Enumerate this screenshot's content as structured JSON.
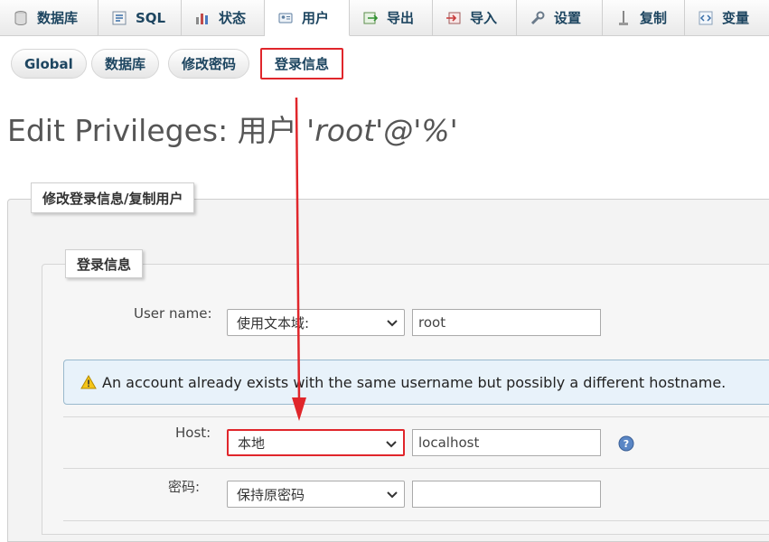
{
  "top_tabs": [
    {
      "label": "数据库",
      "icon": "database-icon"
    },
    {
      "label": "SQL",
      "icon": "sql-icon"
    },
    {
      "label": "状态",
      "icon": "status-icon"
    },
    {
      "label": "用户",
      "icon": "users-icon"
    },
    {
      "label": "导出",
      "icon": "export-icon"
    },
    {
      "label": "导入",
      "icon": "import-icon"
    },
    {
      "label": "设置",
      "icon": "settings-icon"
    },
    {
      "label": "复制",
      "icon": "replication-icon"
    },
    {
      "label": "变量",
      "icon": "variables-icon"
    }
  ],
  "active_top_tab": "用户",
  "sub_tabs": [
    "Global",
    "数据库",
    "修改密码",
    "登录信息"
  ],
  "active_sub_tab": "登录信息",
  "page_title": {
    "prefix": "Edit Privileges: 用户 ",
    "account": "'root'@'%'"
  },
  "fieldset_outer_legend": "修改登录信息/复制用户",
  "fieldset_inner_legend": "登录信息",
  "form": {
    "username_label": "User name:",
    "username_select": "使用文本域:",
    "username_value": "root",
    "notice": "An account already exists with the same username but possibly a different hostname.",
    "host_label": "Host:",
    "host_select": "本地",
    "host_value": "localhost",
    "password_label": "密码:",
    "password_select": "保持原密码",
    "password_value": ""
  },
  "colors": {
    "highlight": "#e0262b",
    "tab_text": "#1d4560",
    "notice_bg": "#e8f2fa"
  }
}
